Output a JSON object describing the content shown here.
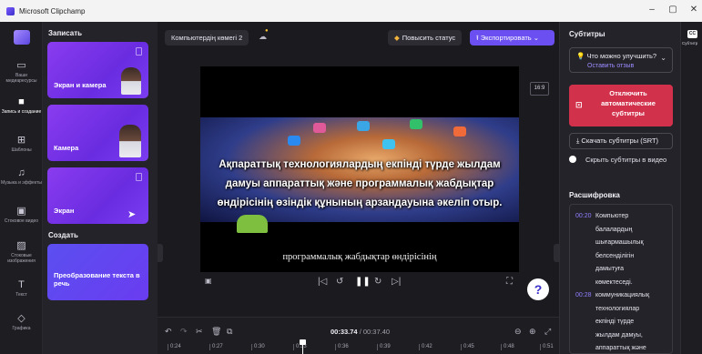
{
  "window": {
    "title": "Microsoft Clipchamp",
    "minimize": "–",
    "maximize": "▢",
    "close": "✕"
  },
  "rail": [
    {
      "label": "Ваши медиаресурсы",
      "icon": "folder-icon",
      "glyph": "▭"
    },
    {
      "label": "Запись и создание",
      "icon": "camera-icon",
      "glyph": "■"
    },
    {
      "label": "Шаблоны",
      "icon": "templates-icon",
      "glyph": "⊞"
    },
    {
      "label": "Музыка и эффекты",
      "icon": "music-icon",
      "glyph": "♫"
    },
    {
      "label": "Стоковое видео",
      "icon": "stock-video-icon",
      "glyph": "▣"
    },
    {
      "label": "Стоковые изображения",
      "icon": "stock-image-icon",
      "glyph": "▨"
    },
    {
      "label": "Текст",
      "icon": "text-icon",
      "glyph": "T"
    },
    {
      "label": "Графика",
      "icon": "graphics-icon",
      "glyph": "◇"
    }
  ],
  "panel": {
    "section_record": "Записать",
    "cards": [
      {
        "label": "Экран и камера"
      },
      {
        "label": "Камера"
      },
      {
        "label": "Экран"
      }
    ],
    "section_create": "Создать",
    "tts_card": "Преобразование текста в речь"
  },
  "topbar": {
    "project_name": "Компьютердің көмегі 2",
    "upgrade": "Повысить статус",
    "export": "Экспортировать"
  },
  "stage": {
    "aspect": "16:9",
    "overlay_text": "Ақпараттық технологиялардың екпінді түрде жылдам дамуы аппараттық және программалық жабдықтар өндірісінің өзіндік құнының арзандауына әкеліп отыр.",
    "caption": "программалық жабдықтар өндірісінің",
    "help": "?"
  },
  "timeline": {
    "current": "00:33.74",
    "total": "/ 00:37.40",
    "ticks": [
      "0:24",
      "0:27",
      "0:30",
      "0:33",
      "0:36",
      "0:39",
      "0:42",
      "0:45",
      "0:48",
      "0:51"
    ]
  },
  "subtitles": {
    "header": "Субтитры",
    "improve_question": "Что можно улучшить?",
    "improve_link": "Оставить отзыв",
    "disable_btn": "Отключить автоматические субтитры",
    "download_btn": "Скачать субтитры (SRT)",
    "hide_toggle": "Скрыть субтитры в видео",
    "transcript_header": "Расшифровка",
    "transcript": [
      {
        "ts": "00:20",
        "text": "Компьютер"
      },
      {
        "ts": "",
        "text": "балалардың"
      },
      {
        "ts": "",
        "text": "шығармашылық"
      },
      {
        "ts": "",
        "text": "белсенділігін"
      },
      {
        "ts": "",
        "text": "дамытуға"
      },
      {
        "ts": "",
        "text": "көмектеседі."
      },
      {
        "ts": "00:28",
        "text": "коммуникациялық"
      },
      {
        "ts": "",
        "text": "технологиялар"
      },
      {
        "ts": "",
        "text": "екпінді түрде"
      },
      {
        "ts": "",
        "text": "жылдам дамуы,"
      },
      {
        "ts": "",
        "text": "аппараттық және"
      }
    ]
  },
  "right_strip": {
    "cc": "CC",
    "label": "Субтитр"
  }
}
